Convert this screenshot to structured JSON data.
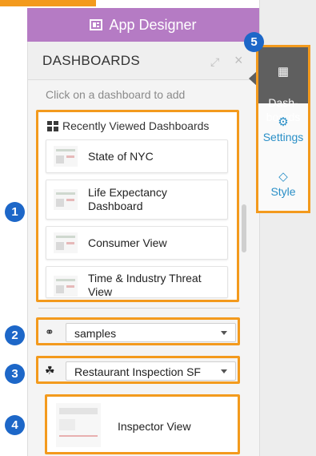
{
  "designer": {
    "title": "App Designer"
  },
  "panel": {
    "title": "DASHBOARDS",
    "hint": "Click on a dashboard to add"
  },
  "recent": {
    "title": "Recently Viewed Dashboards",
    "items": [
      {
        "name": "State of NYC"
      },
      {
        "name": "Life Expectancy Dashboard"
      },
      {
        "name": "Consumer View"
      },
      {
        "name": "Time & Industry Threat View"
      }
    ]
  },
  "selectors": {
    "source": "samples",
    "dataset": "Restaurant Inspection SF"
  },
  "selected_dashboard": {
    "name": "Inspector View"
  },
  "side_tabs": [
    {
      "label": "Dash-\nboards",
      "icon": "dashboard-grid-icon",
      "active": true
    },
    {
      "label": "Settings",
      "icon": "cogs-icon",
      "active": false
    },
    {
      "label": "Style",
      "icon": "diamond-icon",
      "active": false
    }
  ],
  "badges": [
    "1",
    "2",
    "3",
    "4",
    "5"
  ],
  "colors": {
    "highlight": "#f39a1d",
    "designer_bar": "#b57bc4",
    "badge": "#1d67c8",
    "active_tab": "#5f5f5f",
    "tab_text": "#2a8fc7"
  }
}
